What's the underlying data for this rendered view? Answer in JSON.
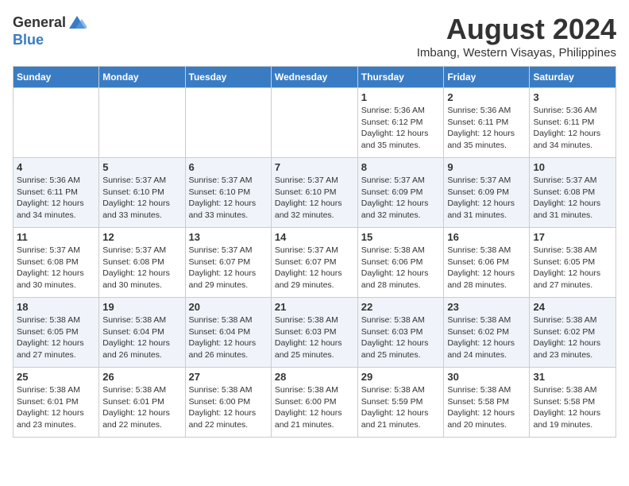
{
  "header": {
    "logo_general": "General",
    "logo_blue": "Blue",
    "month_title": "August 2024",
    "location": "Imbang, Western Visayas, Philippines"
  },
  "days_of_week": [
    "Sunday",
    "Monday",
    "Tuesday",
    "Wednesday",
    "Thursday",
    "Friday",
    "Saturday"
  ],
  "weeks": [
    [
      {
        "day": "",
        "info": ""
      },
      {
        "day": "",
        "info": ""
      },
      {
        "day": "",
        "info": ""
      },
      {
        "day": "",
        "info": ""
      },
      {
        "day": "1",
        "info": "Sunrise: 5:36 AM\nSunset: 6:12 PM\nDaylight: 12 hours\nand 35 minutes."
      },
      {
        "day": "2",
        "info": "Sunrise: 5:36 AM\nSunset: 6:11 PM\nDaylight: 12 hours\nand 35 minutes."
      },
      {
        "day": "3",
        "info": "Sunrise: 5:36 AM\nSunset: 6:11 PM\nDaylight: 12 hours\nand 34 minutes."
      }
    ],
    [
      {
        "day": "4",
        "info": "Sunrise: 5:36 AM\nSunset: 6:11 PM\nDaylight: 12 hours\nand 34 minutes."
      },
      {
        "day": "5",
        "info": "Sunrise: 5:37 AM\nSunset: 6:10 PM\nDaylight: 12 hours\nand 33 minutes."
      },
      {
        "day": "6",
        "info": "Sunrise: 5:37 AM\nSunset: 6:10 PM\nDaylight: 12 hours\nand 33 minutes."
      },
      {
        "day": "7",
        "info": "Sunrise: 5:37 AM\nSunset: 6:10 PM\nDaylight: 12 hours\nand 32 minutes."
      },
      {
        "day": "8",
        "info": "Sunrise: 5:37 AM\nSunset: 6:09 PM\nDaylight: 12 hours\nand 32 minutes."
      },
      {
        "day": "9",
        "info": "Sunrise: 5:37 AM\nSunset: 6:09 PM\nDaylight: 12 hours\nand 31 minutes."
      },
      {
        "day": "10",
        "info": "Sunrise: 5:37 AM\nSunset: 6:08 PM\nDaylight: 12 hours\nand 31 minutes."
      }
    ],
    [
      {
        "day": "11",
        "info": "Sunrise: 5:37 AM\nSunset: 6:08 PM\nDaylight: 12 hours\nand 30 minutes."
      },
      {
        "day": "12",
        "info": "Sunrise: 5:37 AM\nSunset: 6:08 PM\nDaylight: 12 hours\nand 30 minutes."
      },
      {
        "day": "13",
        "info": "Sunrise: 5:37 AM\nSunset: 6:07 PM\nDaylight: 12 hours\nand 29 minutes."
      },
      {
        "day": "14",
        "info": "Sunrise: 5:37 AM\nSunset: 6:07 PM\nDaylight: 12 hours\nand 29 minutes."
      },
      {
        "day": "15",
        "info": "Sunrise: 5:38 AM\nSunset: 6:06 PM\nDaylight: 12 hours\nand 28 minutes."
      },
      {
        "day": "16",
        "info": "Sunrise: 5:38 AM\nSunset: 6:06 PM\nDaylight: 12 hours\nand 28 minutes."
      },
      {
        "day": "17",
        "info": "Sunrise: 5:38 AM\nSunset: 6:05 PM\nDaylight: 12 hours\nand 27 minutes."
      }
    ],
    [
      {
        "day": "18",
        "info": "Sunrise: 5:38 AM\nSunset: 6:05 PM\nDaylight: 12 hours\nand 27 minutes."
      },
      {
        "day": "19",
        "info": "Sunrise: 5:38 AM\nSunset: 6:04 PM\nDaylight: 12 hours\nand 26 minutes."
      },
      {
        "day": "20",
        "info": "Sunrise: 5:38 AM\nSunset: 6:04 PM\nDaylight: 12 hours\nand 26 minutes."
      },
      {
        "day": "21",
        "info": "Sunrise: 5:38 AM\nSunset: 6:03 PM\nDaylight: 12 hours\nand 25 minutes."
      },
      {
        "day": "22",
        "info": "Sunrise: 5:38 AM\nSunset: 6:03 PM\nDaylight: 12 hours\nand 25 minutes."
      },
      {
        "day": "23",
        "info": "Sunrise: 5:38 AM\nSunset: 6:02 PM\nDaylight: 12 hours\nand 24 minutes."
      },
      {
        "day": "24",
        "info": "Sunrise: 5:38 AM\nSunset: 6:02 PM\nDaylight: 12 hours\nand 23 minutes."
      }
    ],
    [
      {
        "day": "25",
        "info": "Sunrise: 5:38 AM\nSunset: 6:01 PM\nDaylight: 12 hours\nand 23 minutes."
      },
      {
        "day": "26",
        "info": "Sunrise: 5:38 AM\nSunset: 6:01 PM\nDaylight: 12 hours\nand 22 minutes."
      },
      {
        "day": "27",
        "info": "Sunrise: 5:38 AM\nSunset: 6:00 PM\nDaylight: 12 hours\nand 22 minutes."
      },
      {
        "day": "28",
        "info": "Sunrise: 5:38 AM\nSunset: 6:00 PM\nDaylight: 12 hours\nand 21 minutes."
      },
      {
        "day": "29",
        "info": "Sunrise: 5:38 AM\nSunset: 5:59 PM\nDaylight: 12 hours\nand 21 minutes."
      },
      {
        "day": "30",
        "info": "Sunrise: 5:38 AM\nSunset: 5:58 PM\nDaylight: 12 hours\nand 20 minutes."
      },
      {
        "day": "31",
        "info": "Sunrise: 5:38 AM\nSunset: 5:58 PM\nDaylight: 12 hours\nand 19 minutes."
      }
    ]
  ]
}
